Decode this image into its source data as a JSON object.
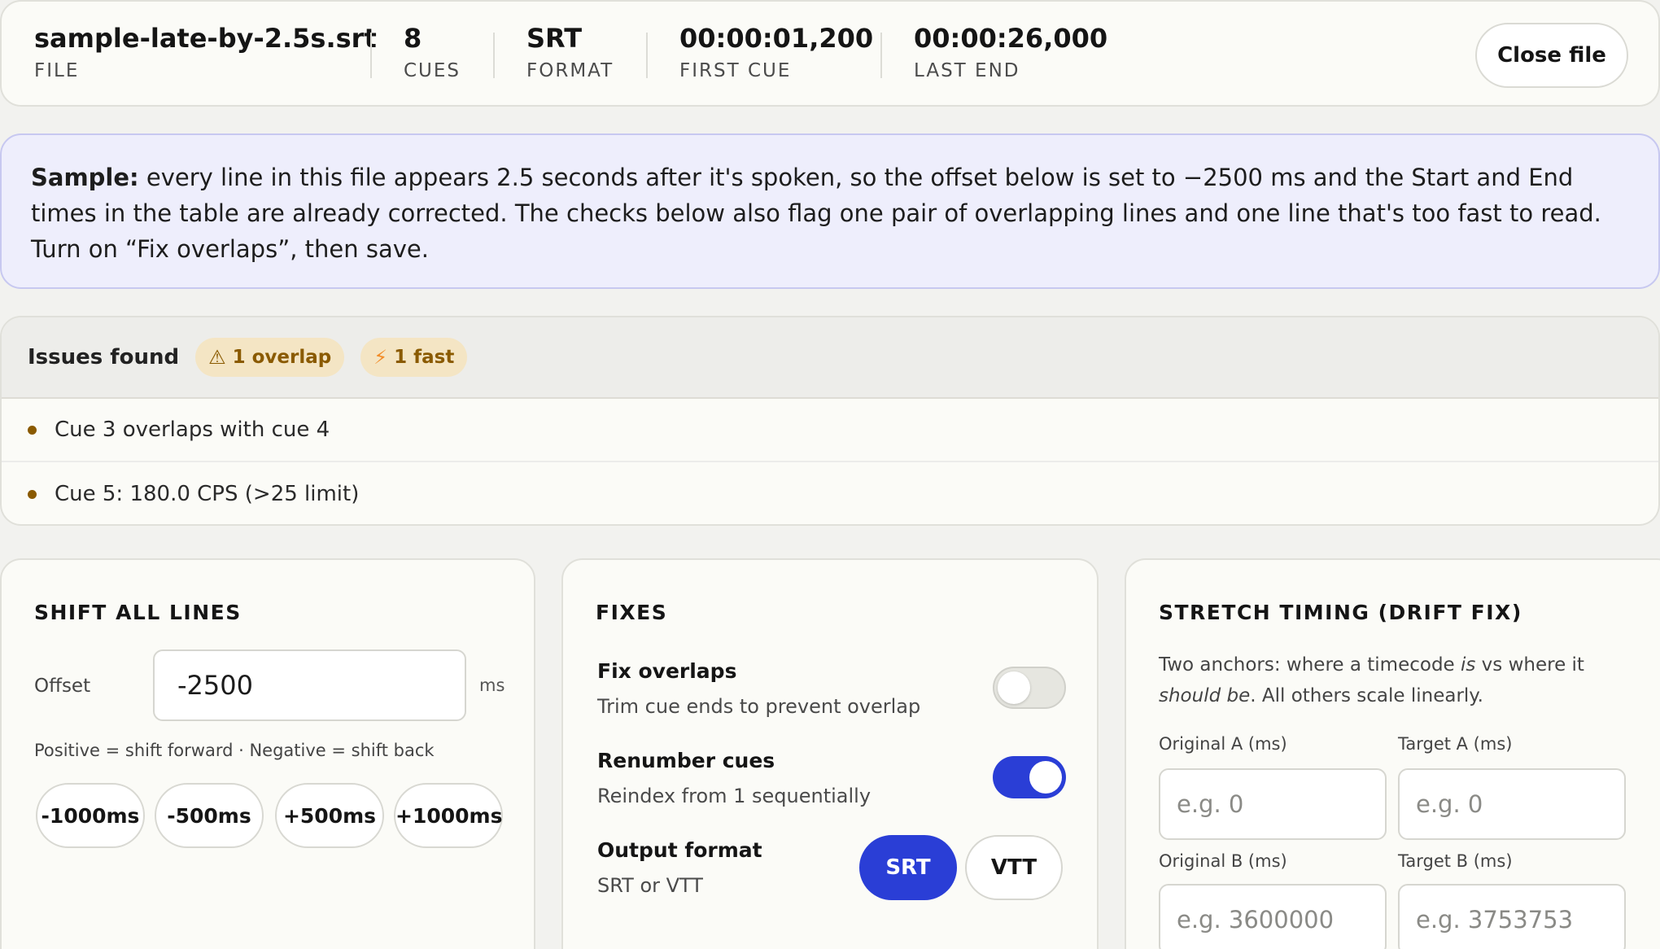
{
  "header": {
    "file_name": "sample-late-by-2.5s.srt",
    "file_label": "FILE",
    "cues_value": "8",
    "cues_label": "CUES",
    "format_value": "SRT",
    "format_label": "FORMAT",
    "first_cue_value": "00:00:01,200",
    "first_cue_label": "FIRST CUE",
    "last_end_value": "00:00:26,000",
    "last_end_label": "LAST END",
    "close_label": "Close file"
  },
  "banner": {
    "bold": "Sample:",
    "text": " every line in this file appears 2.5 seconds after it's spoken, so the offset below is set to −2500 ms and the Start and End times in the table are already corrected. The checks below also flag one pair of overlapping lines and one line that's too fast to read. Turn on “Fix overlaps”, then save."
  },
  "issues": {
    "title": "Issues found",
    "overlap_badge": "1 overlap",
    "fast_badge": "1 fast",
    "items": [
      "Cue 3 overlaps with cue 4",
      "Cue 5: 180.0 CPS (>25 limit)"
    ]
  },
  "shift": {
    "title": "SHIFT ALL LINES",
    "offset_label": "Offset",
    "offset_value": "-2500",
    "unit": "ms",
    "hint": "Positive = shift forward · Negative = shift back",
    "buttons": [
      "-1000ms",
      "-500ms",
      "+500ms",
      "+1000ms"
    ]
  },
  "fixes": {
    "title": "FIXES",
    "overlaps_title": "Fix overlaps",
    "overlaps_desc": "Trim cue ends to prevent overlap",
    "overlaps_on": false,
    "renumber_title": "Renumber cues",
    "renumber_desc": "Reindex from 1 sequentially",
    "renumber_on": true,
    "format_title": "Output format",
    "format_desc": "SRT or VTT",
    "format_srt": "SRT",
    "format_vtt": "VTT",
    "format_selected": "SRT"
  },
  "stretch": {
    "title": "STRETCH TIMING (DRIFT FIX)",
    "desc_1": "Two anchors: where a timecode ",
    "desc_is": "is",
    "desc_2": " vs where it ",
    "desc_should": "should be",
    "desc_3": ". All others scale linearly.",
    "orig_a_label": "Original A (ms)",
    "orig_a_placeholder": "e.g. 0",
    "target_a_label": "Target A (ms)",
    "target_a_placeholder": "e.g. 0",
    "orig_b_label": "Original B (ms)",
    "orig_b_placeholder": "e.g. 3600000",
    "target_b_label": "Target B (ms)",
    "target_b_placeholder": "e.g. 3753753"
  },
  "colors": {
    "accent": "#2a3ed6",
    "banner_bg": "#eeeefc",
    "badge_bg": "#f4e5c4",
    "badge_text": "#8a5a00"
  }
}
